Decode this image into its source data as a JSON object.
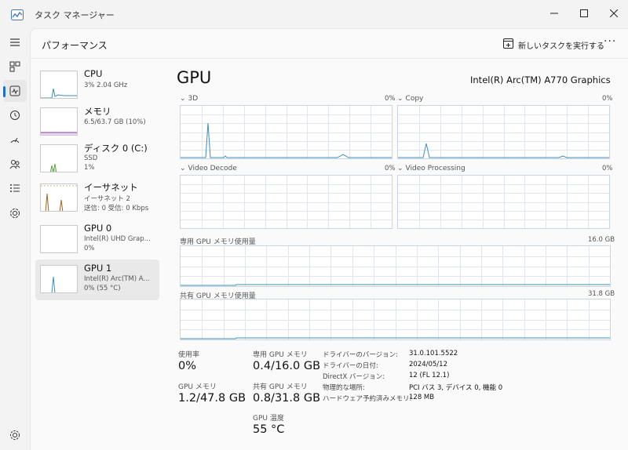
{
  "window": {
    "title": "タスク マネージャー"
  },
  "header": {
    "title": "パフォーマンス",
    "run_task": "新しいタスクを実行する",
    "more": "···"
  },
  "rail": {
    "icons": [
      "hamburger-icon",
      "processes-icon",
      "performance-icon",
      "app-history-icon",
      "startup-icon",
      "users-icon",
      "details-icon",
      "services-icon"
    ],
    "settings_icon": "settings-icon"
  },
  "devices": [
    {
      "name": "CPU",
      "sub1": "3%  2.04 GHz",
      "sub2": "",
      "sub3": ""
    },
    {
      "name": "メモリ",
      "sub1": "6.5/63.7 GB (10%)",
      "sub2": "",
      "sub3": ""
    },
    {
      "name": "ディスク 0 (C:)",
      "sub1": "SSD",
      "sub2": "1%",
      "sub3": ""
    },
    {
      "name": "イーサネット",
      "sub1": "イーサネット 2",
      "sub2": "送信: 0 受信: 0 Kbps",
      "sub3": ""
    },
    {
      "name": "GPU 0",
      "sub1": "Intel(R) UHD Grap...",
      "sub2": "0%",
      "sub3": ""
    },
    {
      "name": "GPU 1",
      "sub1": "Intel(R) Arc(TM) A...",
      "sub2": "0%  (55 °C)",
      "sub3": ""
    }
  ],
  "gpu": {
    "title": "GPU",
    "model": "Intel(R) Arc(TM) A770 Graphics",
    "engines": [
      {
        "name": "3D",
        "pct": "0%"
      },
      {
        "name": "Copy",
        "pct": "0%"
      },
      {
        "name": "Video Decode",
        "pct": "0%"
      },
      {
        "name": "Video Processing",
        "pct": "0%"
      }
    ],
    "dedicated": {
      "label": "専用 GPU メモリ使用量",
      "max": "16.0 GB"
    },
    "shared": {
      "label": "共有 GPU メモリ使用量",
      "max": "31.8 GB"
    }
  },
  "stats": {
    "utilization_label": "使用率",
    "utilization": "0%",
    "gpu_memory_label": "GPU メモリ",
    "gpu_memory": "1.2/47.8 GB",
    "dedicated_label": "専用 GPU メモリ",
    "dedicated": "0.4/16.0 GB",
    "shared_label": "共有 GPU メモリ",
    "shared": "0.8/31.8 GB",
    "temp_label": "GPU 温度",
    "temp": "55 °C"
  },
  "info": [
    {
      "label": "ドライバーのバージョン:",
      "value": "31.0.101.5522"
    },
    {
      "label": "ドライバーの日付:",
      "value": "2024/05/12"
    },
    {
      "label": "DirectX バージョン:",
      "value": "12 (FL 12.1)"
    },
    {
      "label": "物理的な場所:",
      "value": "PCI バス 3, デバイス 0, 機能 0"
    },
    {
      "label": "ハードウェア予約済みメモリ:",
      "value": "128 MB"
    }
  ],
  "colors": {
    "accent": "#1f6fc5",
    "gpu_line": "#3c8fb8",
    "memory_line": "#8b3d9e",
    "disk_line": "#4d9a2f",
    "ethernet_line": "#a0651c",
    "grid": "#dfe6ee"
  }
}
